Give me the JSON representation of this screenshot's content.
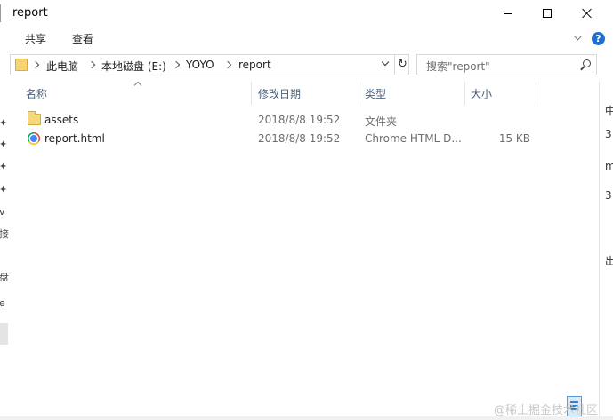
{
  "window": {
    "title": "report"
  },
  "ribbon": {
    "tabs": [
      "共享",
      "查看"
    ],
    "help_symbol": "?"
  },
  "address_bar": {
    "breadcrumbs": [
      "此电脑",
      "本地磁盘 (E:)",
      "YOYO",
      "report"
    ],
    "refresh_symbol": "↻"
  },
  "search": {
    "placeholder": "搜索\"report\""
  },
  "columns": {
    "name": "名称",
    "date": "修改日期",
    "type": "类型",
    "size": "大小"
  },
  "files": [
    {
      "name": "assets",
      "date": "2018/8/8 19:52",
      "type": "文件夹",
      "size": "",
      "icon": "folder-icon"
    },
    {
      "name": "report.html",
      "date": "2018/8/8 19:52",
      "type": "Chrome HTML D...",
      "size": "15 KB",
      "icon": "chrome-icon"
    }
  ],
  "nav_pane_glyphs": [
    "✦",
    "✦",
    "✦",
    "✦",
    "v",
    "接",
    "盘",
    "e"
  ],
  "background_window_glyphs": [
    "中",
    "3",
    "m",
    "3",
    "出"
  ],
  "watermark": "@稀土掘金技术社区",
  "colors": {
    "header_text": "#4c607a",
    "secondary_text": "#6d6d6d",
    "accent": "#1e6fd0",
    "folder": "#f7d77b"
  }
}
